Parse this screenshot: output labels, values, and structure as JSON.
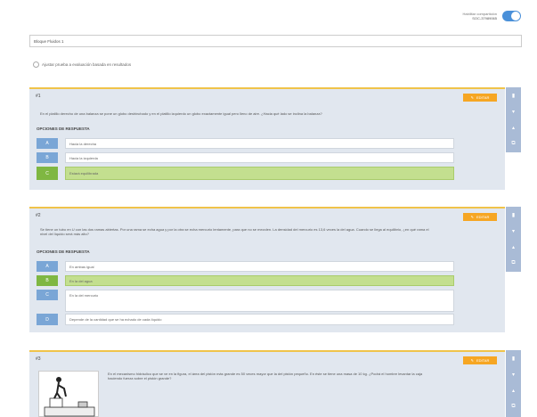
{
  "share": {
    "label": "Habilitar compartición",
    "code": "SOC-37989065",
    "enabled": true
  },
  "title_input": {
    "value": "Bloque Fluidos 1"
  },
  "adjust": {
    "label": "Ajustar prueba a evaluación basada en resultados"
  },
  "common": {
    "edit_label": "EDITAR",
    "options_label": "OPCIONES DE RESPUESTA",
    "accent_color": "#f6a623",
    "correct_color": "#7fb742",
    "letter_color": "#7aa6d6"
  },
  "questions": [
    {
      "number": "#1",
      "text": "En el platillo derecho de una balanza se pone un globo deshinchado y en el platillo izquierdo un globo exactamente igual pero lleno de aire. ¿Hacia qué lado se inclina la balanza?",
      "options": [
        {
          "letter": "A",
          "text": "Hacia la derecha",
          "correct": false
        },
        {
          "letter": "B",
          "text": "Hacia la izquierda",
          "correct": false
        },
        {
          "letter": "C",
          "text": "Estará equilibrada",
          "correct": true
        }
      ]
    },
    {
      "number": "#2",
      "text": "Se tiene un tubo en U con las dos ramas abiertas. Por una rama se echa agua y por la otra se echa mercurio lentamente, para que no se mezclen. La densidad del mercurio es 13,6 veces la del agua. Cuando se llega al equilibrio, ¿en qué rama el nivel del líquido será más alto?",
      "options": [
        {
          "letter": "A",
          "text": "En ambas igual",
          "correct": false
        },
        {
          "letter": "B",
          "text": "En la del agua",
          "correct": true
        },
        {
          "letter": "C",
          "text": "En la del mercurio",
          "correct": false
        },
        {
          "letter": "D",
          "text": "Depende de la cantidad que se ha echado de cada líquido",
          "correct": false
        }
      ]
    },
    {
      "number": "#3",
      "text": "En el mecanismo hidráulico que se ve en la figura, el área del pistón más grande es 50 veces mayor que la del pistón pequeño. En éste se tiene una masa de 10 kg. ¿Podrá el hombre levantar la caja haciendo fuerza sobre el pistón grande?"
    }
  ],
  "side_icons": [
    "trash-icon",
    "arrow-down-icon",
    "arrow-up-icon",
    "copy-icon"
  ]
}
